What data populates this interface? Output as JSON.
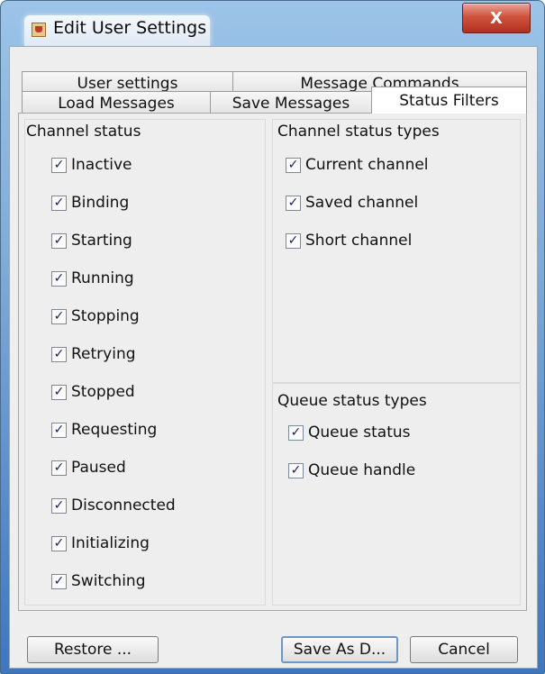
{
  "window": {
    "title": "Edit User Settings",
    "close_label": "X"
  },
  "tabs": {
    "row_back": [
      "User settings",
      "Message Commands"
    ],
    "row_front": [
      "Load Messages",
      "Save Messages",
      "Status Filters"
    ],
    "selected": "Status Filters"
  },
  "channel_status": {
    "title": "Channel status",
    "items": [
      {
        "label": "Inactive",
        "checked": true
      },
      {
        "label": "Binding",
        "checked": true
      },
      {
        "label": "Starting",
        "checked": true
      },
      {
        "label": "Running",
        "checked": true
      },
      {
        "label": "Stopping",
        "checked": true
      },
      {
        "label": "Retrying",
        "checked": true
      },
      {
        "label": "Stopped",
        "checked": true
      },
      {
        "label": "Requesting",
        "checked": true
      },
      {
        "label": "Paused",
        "checked": true
      },
      {
        "label": "Disconnected",
        "checked": true
      },
      {
        "label": "Initializing",
        "checked": true
      },
      {
        "label": "Switching",
        "checked": true
      }
    ]
  },
  "channel_status_types": {
    "title": "Channel status types",
    "items": [
      {
        "label": "Current channel",
        "checked": true
      },
      {
        "label": "Saved channel",
        "checked": true
      },
      {
        "label": "Short channel",
        "checked": true
      }
    ]
  },
  "queue_status_types": {
    "title": "Queue status types",
    "items": [
      {
        "label": "Queue status",
        "checked": true
      },
      {
        "label": "Queue handle",
        "checked": true
      }
    ]
  },
  "buttons": {
    "restore": "Restore ...",
    "save_as": "Save As D...",
    "cancel": "Cancel"
  },
  "check_glyph": "✓"
}
